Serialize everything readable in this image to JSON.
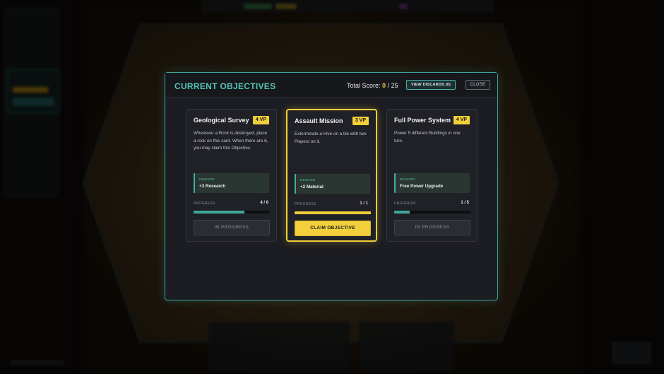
{
  "modal": {
    "title": "CURRENT OBJECTIVES",
    "score_label": "Total Score:",
    "score_current": "0",
    "score_sep": " / ",
    "score_max": "25",
    "view_discards_label": "VIEW DISCARDS (0)",
    "close_label": "CLOSE"
  },
  "cards": [
    {
      "title": "Geological Survey",
      "vp": "4 VP",
      "description": "Whenever a Rock is destroyed, place a rock on this card. When there are 6, you may claim this Objective.",
      "reward_label": "REWARD",
      "reward_value": "+3 Research",
      "progress_label": "PROGRESS",
      "progress_text": "4 / 6",
      "progress_fraction": 0.667,
      "button_label": "IN PROGRESS",
      "claimable": false
    },
    {
      "title": "Assault Mission",
      "vp": "3 VP",
      "description": "Exterminate a Hive on a tile with two Players on it.",
      "reward_label": "REWARD",
      "reward_value": "+2 Material",
      "progress_label": "PROGRESS",
      "progress_text": "1 / 1",
      "progress_fraction": 1.0,
      "button_label": "CLAIM OBJECTIVE",
      "claimable": true
    },
    {
      "title": "Full Power System",
      "vp": "4 VP",
      "description": "Power 5 different Buildings in one turn.",
      "reward_label": "REWARD",
      "reward_value": "Free Power Upgrade",
      "progress_label": "PROGRESS",
      "progress_text": "1 / 5",
      "progress_fraction": 0.2,
      "button_label": "IN PROGRESS",
      "claimable": false
    }
  ],
  "colors": {
    "accent_teal": "#53c3b5",
    "accent_gold": "#f2cf3b",
    "panel_bg": "#1c1d22"
  }
}
